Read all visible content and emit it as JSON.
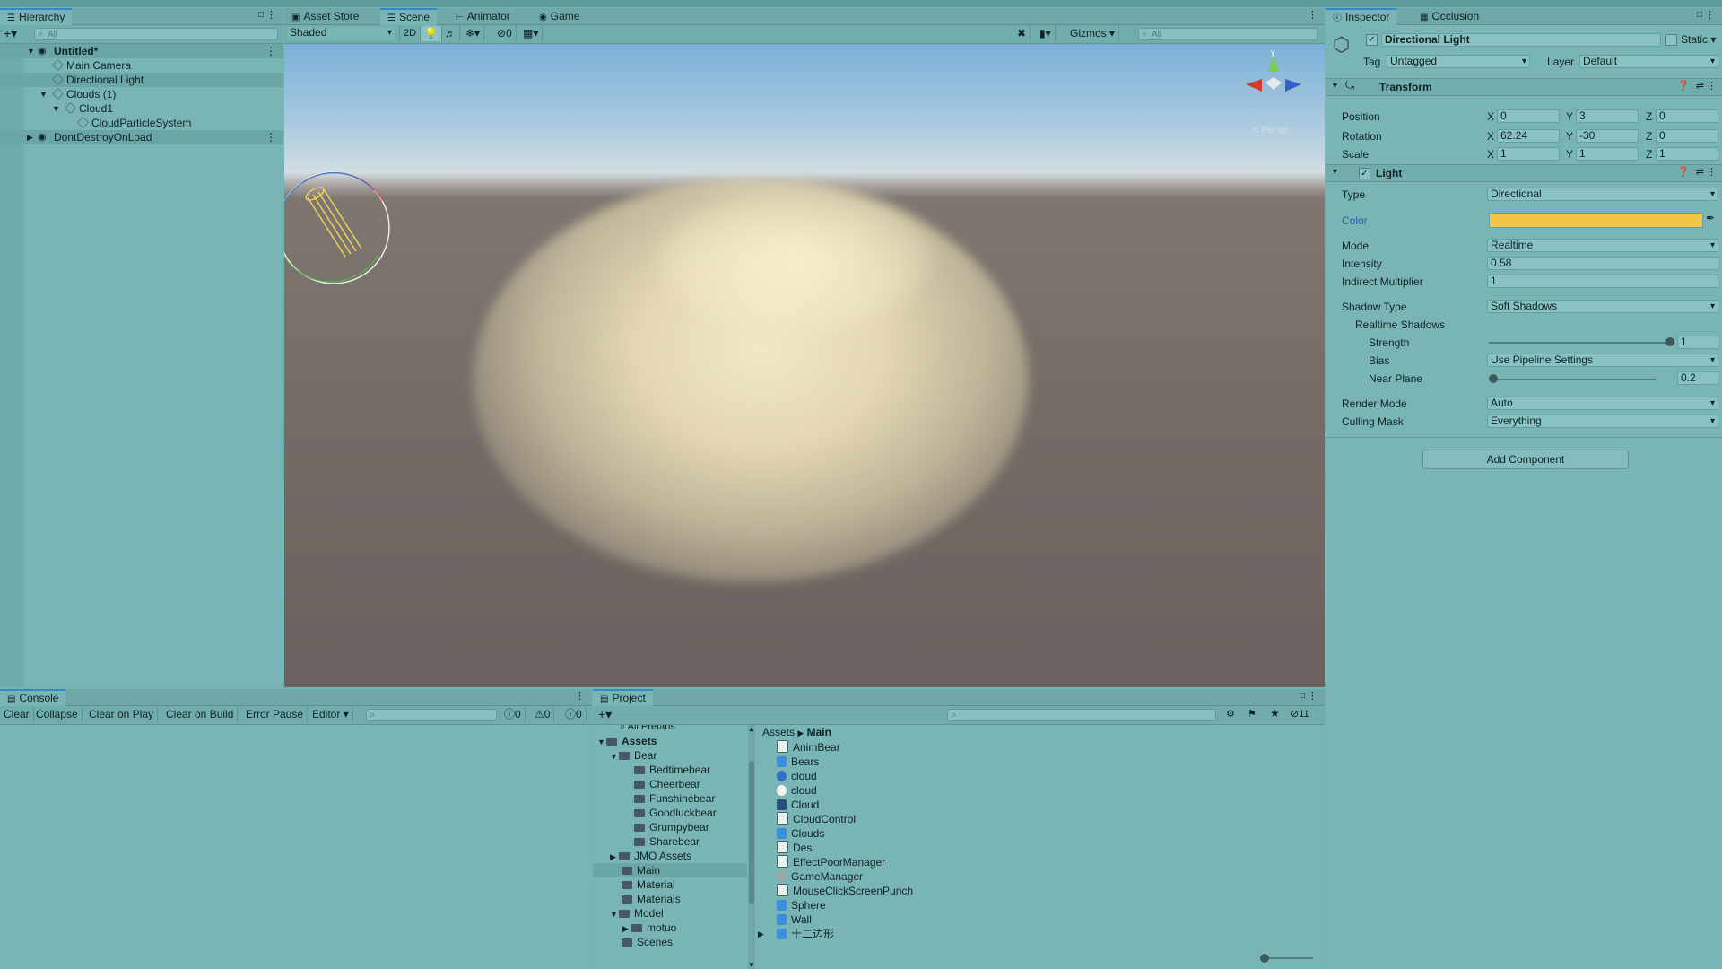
{
  "hierarchy": {
    "tab": "Hierarchy",
    "search_placeholder": "All",
    "items": [
      {
        "label": "Untitled*"
      },
      {
        "label": "Main Camera"
      },
      {
        "label": "Directional Light"
      },
      {
        "label": "Clouds (1)"
      },
      {
        "label": "Cloud1"
      },
      {
        "label": "CloudParticleSystem"
      },
      {
        "label": "DontDestroyOnLoad"
      }
    ]
  },
  "scene_tabs": [
    "Asset Store",
    "Scene",
    "Animator",
    "Game"
  ],
  "scene_toolbar": {
    "shading": "Shaded",
    "mode_2d": "2D",
    "hidden_count": "0",
    "gizmos": "Gizmos",
    "search_placeholder": "All",
    "persp_label": "< Persp"
  },
  "inspector": {
    "tabs": [
      "Inspector",
      "Occlusion"
    ],
    "object_name": "Directional Light",
    "static_label": "Static",
    "tag_label": "Tag",
    "tag_value": "Untagged",
    "layer_label": "Layer",
    "layer_value": "Default",
    "transform": {
      "title": "Transform",
      "position_label": "Position",
      "rotation_label": "Rotation",
      "scale_label": "Scale",
      "position": [
        "0",
        "3",
        "0"
      ],
      "rotation": [
        "62.24",
        "-30",
        "0"
      ],
      "scale": [
        "1",
        "1",
        "1"
      ],
      "axis": [
        "X",
        "Y",
        "Z"
      ]
    },
    "light": {
      "title": "Light",
      "type_label": "Type",
      "type_value": "Directional",
      "color_label": "Color",
      "color_value": "#f1c644",
      "mode_label": "Mode",
      "mode_value": "Realtime",
      "intensity_label": "Intensity",
      "intensity_value": "0.58",
      "indirect_label": "Indirect Multiplier",
      "indirect_value": "1",
      "shadow_type_label": "Shadow Type",
      "shadow_type_value": "Soft Shadows",
      "realtime_shadows_label": "Realtime Shadows",
      "strength_label": "Strength",
      "strength_value": "1",
      "bias_label": "Bias",
      "bias_value": "Use Pipeline Settings",
      "near_plane_label": "Near Plane",
      "near_plane_value": "0.2",
      "render_mode_label": "Render Mode",
      "render_mode_value": "Auto",
      "culling_mask_label": "Culling Mask",
      "culling_mask_value": "Everything"
    },
    "add_component": "Add Component"
  },
  "console": {
    "tab": "Console",
    "buttons": [
      "Clear",
      "Collapse",
      "Clear on Play",
      "Clear on Build",
      "Error Pause",
      "Editor"
    ],
    "counts": [
      "0",
      "0",
      "0"
    ]
  },
  "project": {
    "tab": "Project",
    "hidden_count": "11",
    "all_prefabs": "All Prefabs",
    "breadcrumb": [
      "Assets",
      "Main"
    ],
    "tree": [
      {
        "label": "Assets"
      },
      {
        "label": "Bear"
      },
      {
        "label": "Bedtimebear"
      },
      {
        "label": "Cheerbear"
      },
      {
        "label": "Funshinebear"
      },
      {
        "label": "Goodluckbear"
      },
      {
        "label": "Grumpybear"
      },
      {
        "label": "Sharebear"
      },
      {
        "label": "JMO Assets"
      },
      {
        "label": "Main"
      },
      {
        "label": "Material"
      },
      {
        "label": "Materials"
      },
      {
        "label": "Model"
      },
      {
        "label": "motuo"
      },
      {
        "label": "Scenes"
      }
    ],
    "files": [
      {
        "label": "AnimBear",
        "icon": "script-icon"
      },
      {
        "label": "Bears",
        "icon": "prefab-icon"
      },
      {
        "label": "cloud",
        "icon": "material-icon"
      },
      {
        "label": "cloud",
        "icon": "texture-icon"
      },
      {
        "label": "Cloud",
        "icon": "scene-icon"
      },
      {
        "label": "CloudControl",
        "icon": "script-icon"
      },
      {
        "label": "Clouds",
        "icon": "prefab-icon"
      },
      {
        "label": "Des",
        "icon": "script-icon"
      },
      {
        "label": "EffectPoorManager",
        "icon": "script-icon"
      },
      {
        "label": "GameManager",
        "icon": "settings-icon"
      },
      {
        "label": "MouseClickScreenPunch",
        "icon": "script-icon"
      },
      {
        "label": "Sphere",
        "icon": "prefab-icon"
      },
      {
        "label": "Wall",
        "icon": "prefab-icon"
      },
      {
        "label": "十二边形",
        "icon": "prefab-icon"
      }
    ]
  }
}
